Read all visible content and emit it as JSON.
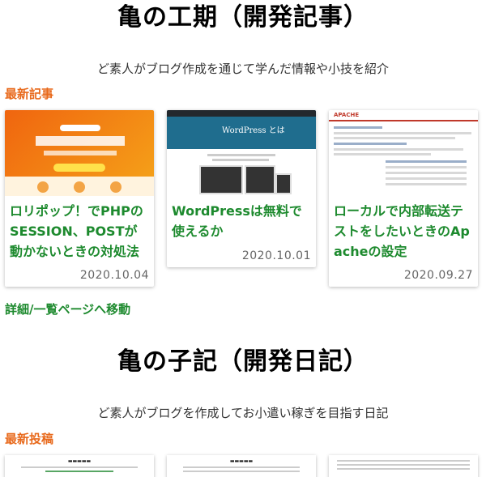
{
  "dev_articles": {
    "title": "亀の工期（開発記事）",
    "description": "ど素人がブログ作成を通じて学んだ情報や小技を紹介",
    "latest_label": "最新記事",
    "posts": [
      {
        "title": "ロリポップ！でPHPのSESSION、POSTが動かないときの対処法",
        "date": "2020.10.04",
        "thumb": "lolipop-thumbnail"
      },
      {
        "title": "WordPressは無料で使えるか",
        "date": "2020.10.01",
        "thumb": "wordpress-thumbnail"
      },
      {
        "title": "ローカルで内部転送テストをしたいときのApacheの設定",
        "date": "2020.09.27",
        "thumb": "apache-thumbnail"
      }
    ],
    "more_link": "詳細/一覧ページへ移動"
  },
  "dev_diary": {
    "title": "亀の子記（開発日記）",
    "description": "ど素人がブログを作成してお小遣い稼ぎを目指す日記",
    "latest_label": "最新投稿"
  },
  "colors": {
    "accent_orange": "#e8691b",
    "link_green": "#1d8a2e"
  }
}
